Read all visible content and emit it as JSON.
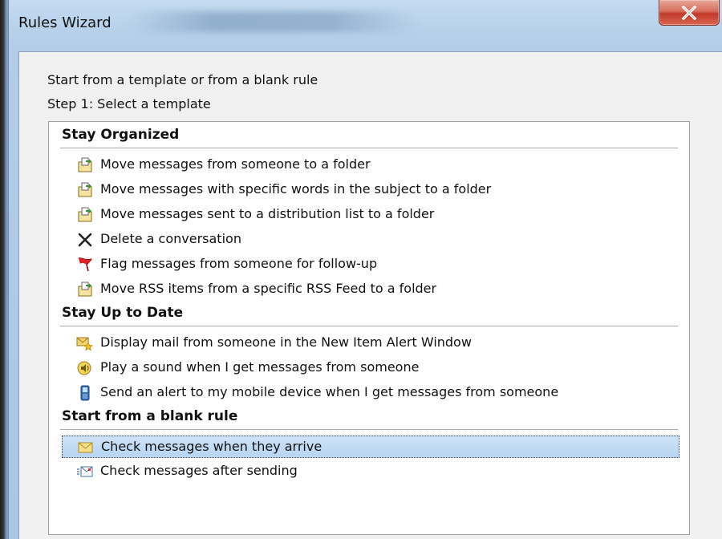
{
  "window": {
    "title": "Rules Wizard",
    "close_glyph": "X"
  },
  "intro": {
    "line1": "Start from a template or from a blank rule",
    "line2": "Step 1: Select a template"
  },
  "groups": [
    {
      "header": "Stay Organized",
      "items": [
        {
          "label": "Move messages from someone to a folder",
          "icon": "move-to-folder-icon"
        },
        {
          "label": "Move messages with specific words in the subject to a folder",
          "icon": "move-to-folder-icon"
        },
        {
          "label": "Move messages sent to a distribution list to a folder",
          "icon": "move-to-folder-icon"
        },
        {
          "label": "Delete a conversation",
          "icon": "delete-x-icon"
        },
        {
          "label": "Flag messages from someone for follow-up",
          "icon": "flag-icon"
        },
        {
          "label": "Move RSS items from a specific RSS Feed to a folder",
          "icon": "move-to-folder-icon"
        }
      ]
    },
    {
      "header": "Stay Up to Date",
      "items": [
        {
          "label": "Display mail from someone in the New Item Alert Window",
          "icon": "new-item-alert-icon"
        },
        {
          "label": "Play a sound when I get messages from someone",
          "icon": "speaker-icon"
        },
        {
          "label": "Send an alert to my mobile device when I get messages from someone",
          "icon": "mobile-device-icon"
        }
      ]
    },
    {
      "header": "Start from a blank rule",
      "items": [
        {
          "label": "Check messages when they arrive",
          "icon": "envelope-icon",
          "selected": true
        },
        {
          "label": "Check messages after sending",
          "icon": "sent-mail-icon"
        }
      ]
    }
  ],
  "colors": {
    "selection": "#b7d4f1",
    "close_button": "#c0392b",
    "title_bar": "#b9d1ea"
  }
}
